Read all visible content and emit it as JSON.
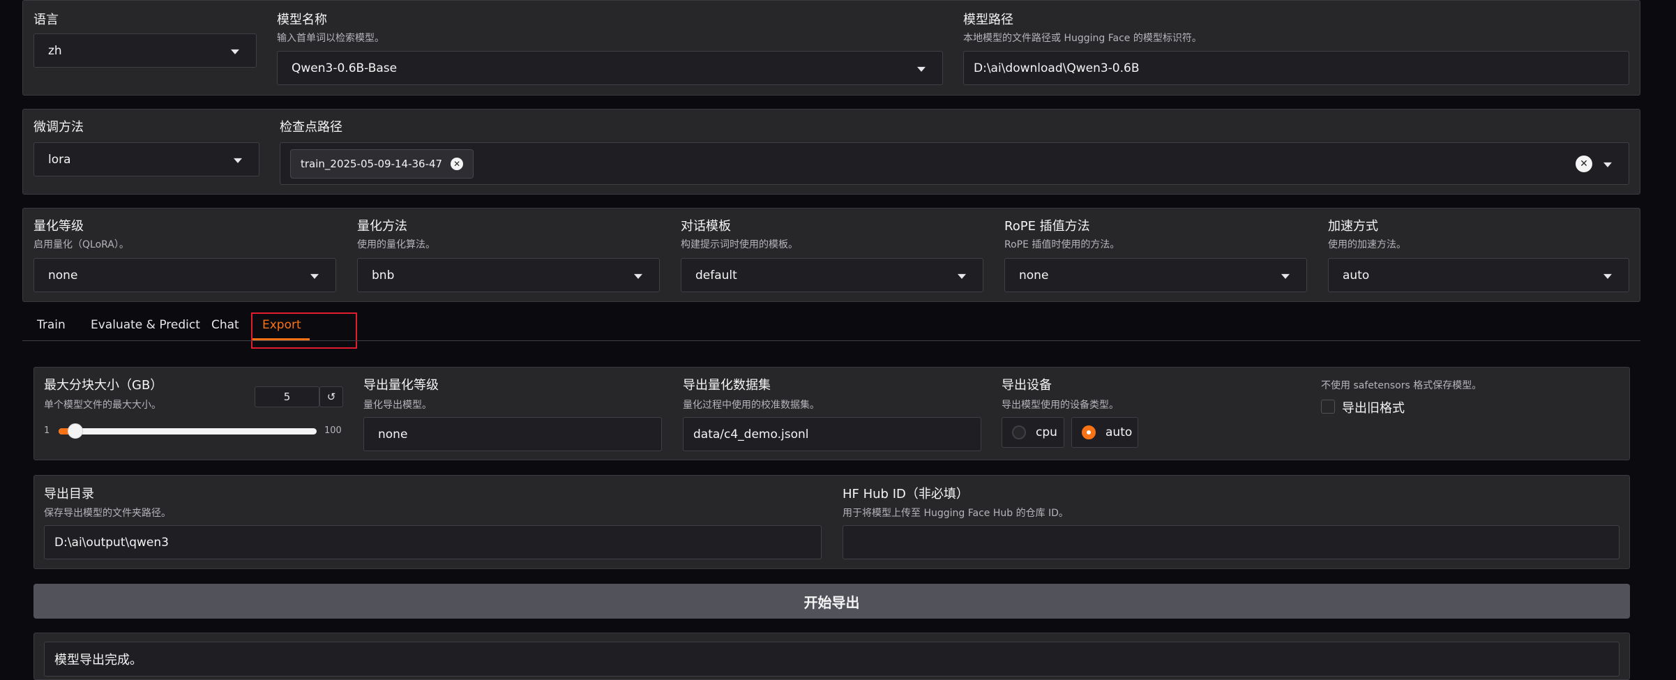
{
  "top": {
    "language": {
      "label": "语言",
      "value": "zh"
    },
    "model_name": {
      "label": "模型名称",
      "info": "输入首单词以检索模型。",
      "value": "Qwen3-0.6B-Base"
    },
    "model_path": {
      "label": "模型路径",
      "info": "本地模型的文件路径或 Hugging Face 的模型标识符。",
      "value": "D:\\ai\\download\\Qwen3-0.6B"
    }
  },
  "finetune": {
    "method": {
      "label": "微调方法",
      "value": "lora"
    },
    "checkpoint": {
      "label": "检查点路径",
      "tag": "train_2025-05-09-14-36-47"
    }
  },
  "advanced": {
    "quant_bit": {
      "label": "量化等级",
      "info": "启用量化（QLoRA）。",
      "value": "none"
    },
    "quant_method": {
      "label": "量化方法",
      "info": "使用的量化算法。",
      "value": "bnb"
    },
    "template": {
      "label": "对话模板",
      "info": "构建提示词时使用的模板。",
      "value": "default"
    },
    "rope": {
      "label": "RoPE 插值方法",
      "info": "RoPE 插值时使用的方法。",
      "value": "none"
    },
    "booster": {
      "label": "加速方式",
      "info": "使用的加速方法。",
      "value": "auto"
    }
  },
  "tabs": [
    "Train",
    "Evaluate & Predict",
    "Chat",
    "Export"
  ],
  "active_tab": "Export",
  "export": {
    "shard_size": {
      "label": "最大分块大小（GB）",
      "info": "单个模型文件的最大大小。",
      "value": "5",
      "min": "1",
      "max": "100",
      "reset_icon": "↺"
    },
    "export_quant_bit": {
      "label": "导出量化等级",
      "info": "量化导出模型。",
      "value": "none"
    },
    "export_quant_dataset": {
      "label": "导出量化数据集",
      "info": "量化过程中使用的校准数据集。",
      "value": "data/c4_demo.jsonl"
    },
    "export_device": {
      "label": "导出设备",
      "info": "导出模型使用的设备类型。",
      "options": [
        "cpu",
        "auto"
      ],
      "selected": "auto"
    },
    "legacy_format": {
      "info": "不使用 safetensors 格式保存模型。",
      "label": "导出旧格式"
    },
    "export_dir": {
      "label": "导出目录",
      "info": "保存导出模型的文件夹路径。",
      "value": "D:\\ai\\output\\qwen3"
    },
    "hub_id": {
      "label": "HF Hub ID（非必填）",
      "info": "用于将模型上传至 Hugging Face Hub 的仓库 ID。",
      "value": ""
    },
    "start_button": "开始导出",
    "output": "模型导出完成。"
  },
  "colors": {
    "accent": "#f97316",
    "highlight_box": "#e11d2e"
  }
}
